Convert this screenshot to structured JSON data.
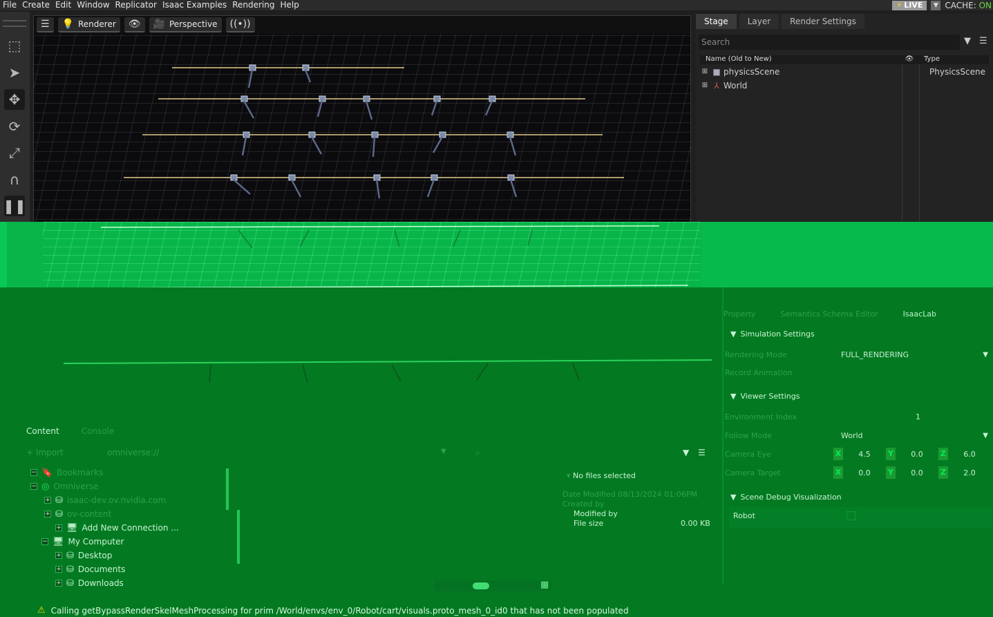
{
  "menu": [
    "File",
    "Create",
    "Edit",
    "Window",
    "Replicator",
    "Isaac Examples",
    "Rendering",
    "Help"
  ],
  "live_label": "LIVE",
  "cache_label": "CACHE:",
  "cache_state": "ON",
  "left_tools": [
    "select-icon",
    "arrow-icon",
    "move-icon",
    "rotate-icon",
    "scale-icon",
    "snap-icon",
    "pause-icon"
  ],
  "viewport": {
    "renderer_label": "Renderer",
    "camera_label": "Perspective"
  },
  "stage": {
    "tabs": [
      "Stage",
      "Layer",
      "Render Settings"
    ],
    "search_placeholder": "Search",
    "col_name": "Name (Old to New)",
    "col_type": "Type",
    "rows": [
      {
        "name": "physicsScene",
        "type": "PhysicsScene"
      },
      {
        "name": "World",
        "type": ""
      }
    ]
  },
  "props": {
    "tabs": [
      "Property",
      "Semantics Schema Editor",
      "IsaacLab"
    ],
    "sim_title": "Simulation Settings",
    "rendering_mode_label": "Rendering Mode",
    "rendering_mode_value": "FULL_RENDERING",
    "record_animation_label": "Record Animation",
    "viewer_title": "Viewer Settings",
    "env_index_label": "Environment Index",
    "env_index_value": "1",
    "follow_mode_label": "Follow Mode",
    "follow_mode_value": "World",
    "camera_eye_label": "Camera Eye",
    "camera_eye": [
      "4.5",
      "0.0",
      "6.0"
    ],
    "camera_target_label": "Camera Target",
    "camera_target": [
      "0.0",
      "0.0",
      "2.0"
    ],
    "debug_title": "Scene Debug Visualization",
    "robot_label": "Robot"
  },
  "content": {
    "tabs": [
      "Content",
      "Console"
    ],
    "import_label": "Import",
    "path_value": "omniverse://",
    "tree": [
      {
        "label": "Bookmarks"
      },
      {
        "label": "Omniverse"
      },
      {
        "label": "isaac-dev.ov.nvidia.com"
      },
      {
        "label": "ov-content"
      },
      {
        "label": "Add New Connection ..."
      },
      {
        "label": "My Computer"
      },
      {
        "label": "Desktop"
      },
      {
        "label": "Documents"
      },
      {
        "label": "Downloads"
      }
    ],
    "no_files": "No files selected",
    "date_modified": "Date Modified 08/13/2024 01:06PM",
    "created_by": "Created by",
    "modified_by": "Modified by",
    "file_size_label": "File size",
    "file_size_value": "0.00 KB"
  },
  "status_message": "Calling getBypassRenderSkelMeshProcessing for prim /World/envs/env_0/Robot/cart/visuals.proto_mesh_0_id0 that has not been populated"
}
